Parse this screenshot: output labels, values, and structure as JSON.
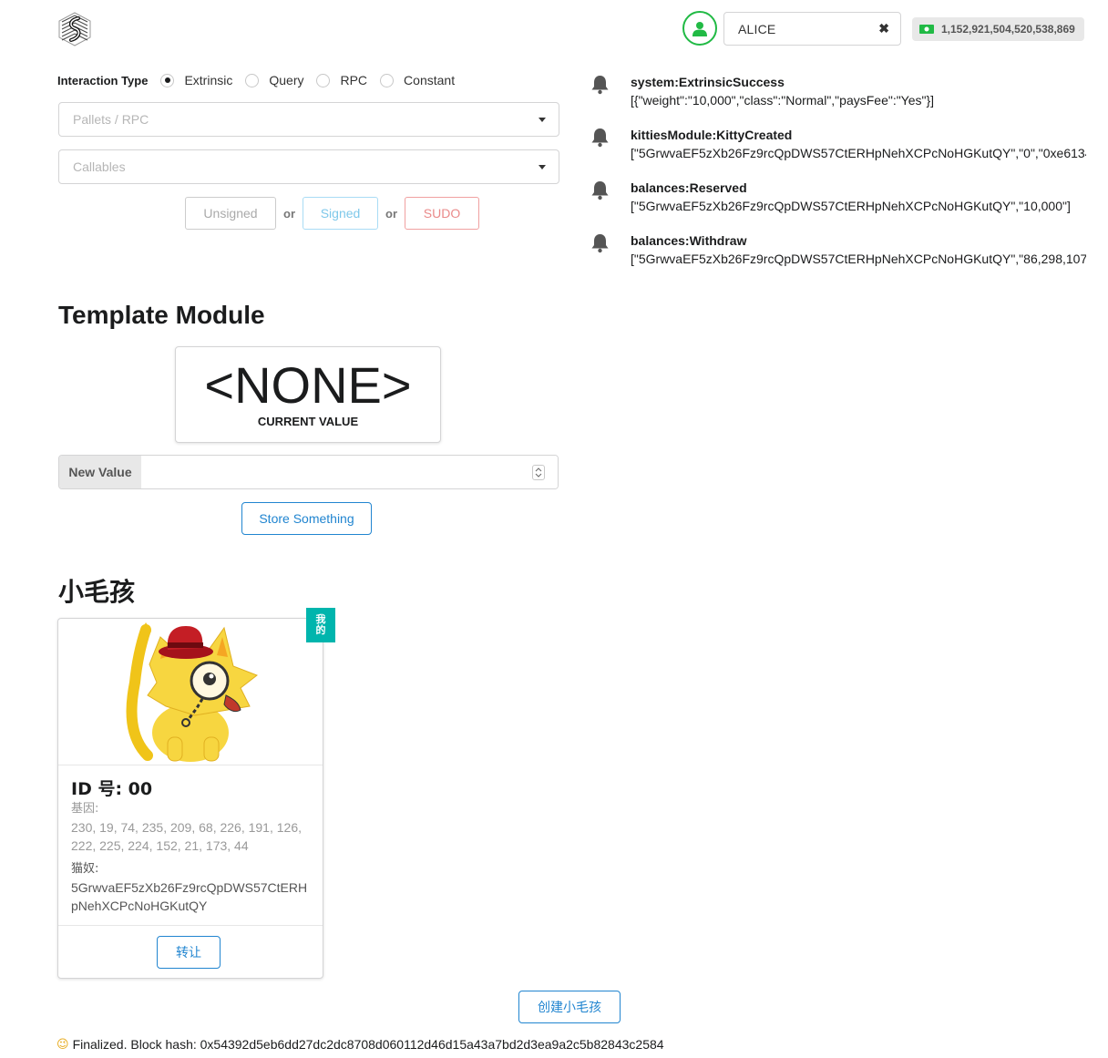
{
  "header": {
    "account": {
      "name": "ALICE",
      "clear_glyph": "✖"
    },
    "balance": "1,152,921,504,520,538,869",
    "icons": {
      "logo": "substrate-logo-icon",
      "avatar": "user-icon",
      "balance": "money-bill-icon"
    }
  },
  "interaction": {
    "label": "Interaction Type",
    "options": [
      "Extrinsic",
      "Query",
      "RPC",
      "Constant"
    ],
    "selected": "Extrinsic",
    "pallets_placeholder": "Pallets / RPC",
    "callables_placeholder": "Callables",
    "buttons": {
      "unsigned": "Unsigned",
      "or1": "or",
      "signed": "Signed",
      "or2": "or",
      "sudo": "SUDO"
    }
  },
  "events": [
    {
      "title": "system:ExtrinsicSuccess",
      "detail": "[{\"weight\":\"10,000\",\"class\":\"Normal\",\"paysFee\":\"Yes\"}]"
    },
    {
      "title": "kittiesModule:KittyCreated",
      "detail": "[\"5GrwvaEF5zXb26Fz9rcQpDWS57CtERHpNehXCPcNoHGKutQY\",\"0\",\"0xe6134"
    },
    {
      "title": "balances:Reserved",
      "detail": "[\"5GrwvaEF5zXb26Fz9rcQpDWS57CtERHpNehXCPcNoHGKutQY\",\"10,000\"]"
    },
    {
      "title": "balances:Withdraw",
      "detail": "[\"5GrwvaEF5zXb26Fz9rcQpDWS57CtERHpNehXCPcNoHGKutQY\",\"86,298,107'"
    }
  ],
  "template_module": {
    "title": "Template Module",
    "current_value": "<NONE>",
    "current_label": "CURRENT VALUE",
    "new_value_label": "New Value",
    "new_value": "",
    "store_button": "Store Something"
  },
  "kitties": {
    "title": "小毛孩",
    "ribbon": "我的",
    "card": {
      "id": "ID 号: 00",
      "dna_label": "基因:",
      "dna": "230, 19, 74, 235, 209, 68, 226, 191, 126, 222, 225, 224, 152, 21, 173, 44",
      "owner_label": "猫奴:",
      "owner": "5GrwvaEF5zXb26Fz9rcQpDWS57CtERHpNehXCPcNoHGKutQY",
      "transfer_button": "转让"
    },
    "create_button": "创建小毛孩"
  },
  "status": {
    "emoji": "😉",
    "text": "Finalized. Block hash: 0x54392d5eb6dd27dc2dc8708d060112d46d15a43a7bd2d3ea9a2c5b82843c2584"
  },
  "colors": {
    "green": "#21ba45",
    "blue": "#2185d0",
    "red": "#db2828",
    "teal": "#00b5ad",
    "signed": "#54c8ff"
  }
}
